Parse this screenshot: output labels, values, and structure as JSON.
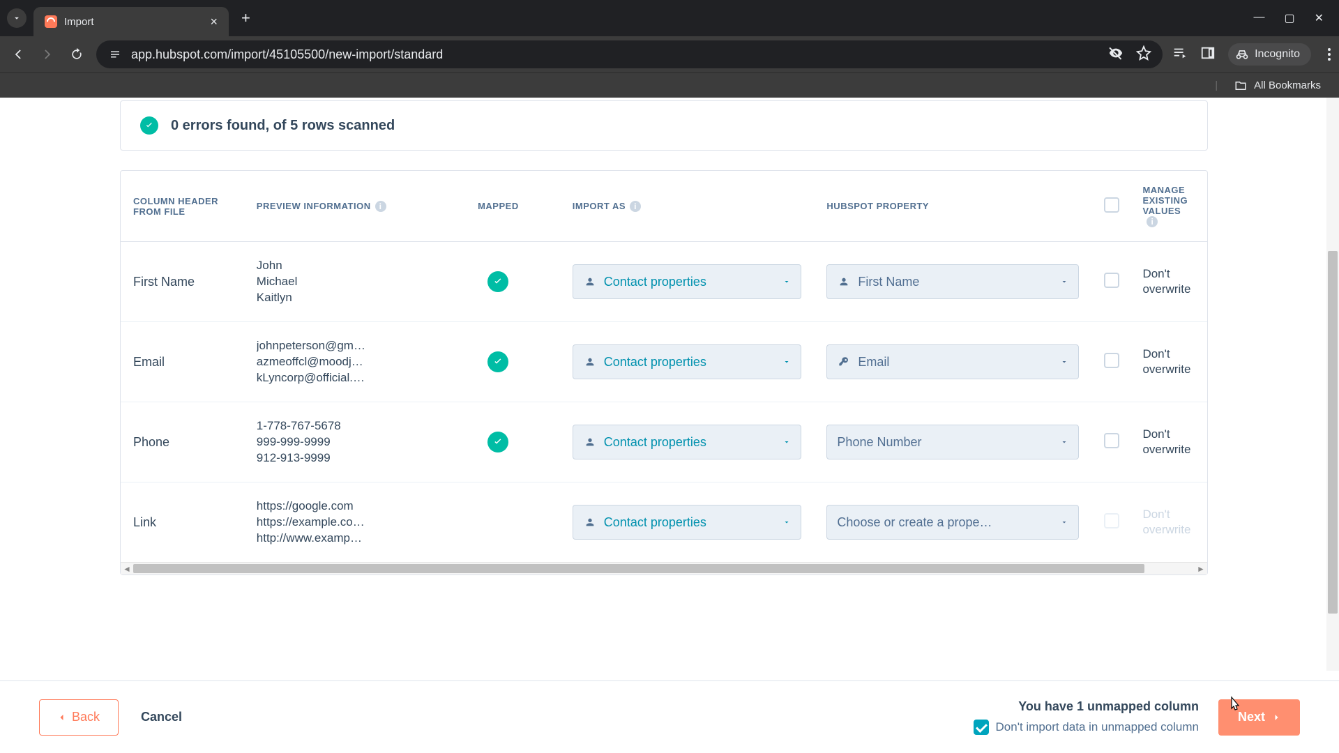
{
  "browser": {
    "tab_title": "Import",
    "url": "app.hubspot.com/import/45105500/new-import/standard",
    "incognito_label": "Incognito",
    "bookmarks_label": "All Bookmarks"
  },
  "status": {
    "text": "0 errors found, of 5 rows scanned"
  },
  "headers": {
    "column_header": "COLUMN HEADER FROM FILE",
    "preview": "PREVIEW INFORMATION",
    "mapped": "MAPPED",
    "import_as": "IMPORT AS",
    "property": "HUBSPOT PROPERTY",
    "manage": "MANAGE EXISTING VALUES"
  },
  "rows": [
    {
      "header": "First Name",
      "preview": [
        "John",
        "Michael",
        "Kaitlyn"
      ],
      "mapped": true,
      "import_as": "Contact properties",
      "property": "First Name",
      "property_icon": "person",
      "overwrite_label": "Don't overwrite",
      "overwrite_disabled": false
    },
    {
      "header": "Email",
      "preview": [
        "johnpeterson@gm…",
        "azmeoffcl@moodj…",
        "kLyncorp@official.…"
      ],
      "mapped": true,
      "import_as": "Contact properties",
      "property": "Email",
      "property_icon": "key",
      "overwrite_label": "Don't overwrite",
      "overwrite_disabled": false
    },
    {
      "header": "Phone",
      "preview": [
        "1-778-767-5678",
        "999-999-9999",
        "912-913-9999"
      ],
      "mapped": true,
      "import_as": "Contact properties",
      "property": "Phone Number",
      "property_icon": "none",
      "overwrite_label": "Don't overwrite",
      "overwrite_disabled": false
    },
    {
      "header": "Link",
      "preview": [
        "https://google.com",
        "https://example.co…",
        "http://www.examp…"
      ],
      "mapped": false,
      "import_as": "Contact properties",
      "property": "Choose or create a prope…",
      "property_icon": "none",
      "overwrite_label": "Don't overwrite",
      "overwrite_disabled": true
    }
  ],
  "footer": {
    "back": "Back",
    "cancel": "Cancel",
    "next": "Next",
    "unmapped_title": "You have 1 unmapped column",
    "unmapped_checkbox": "Don't import data in unmapped column",
    "unmapped_checked": true
  }
}
